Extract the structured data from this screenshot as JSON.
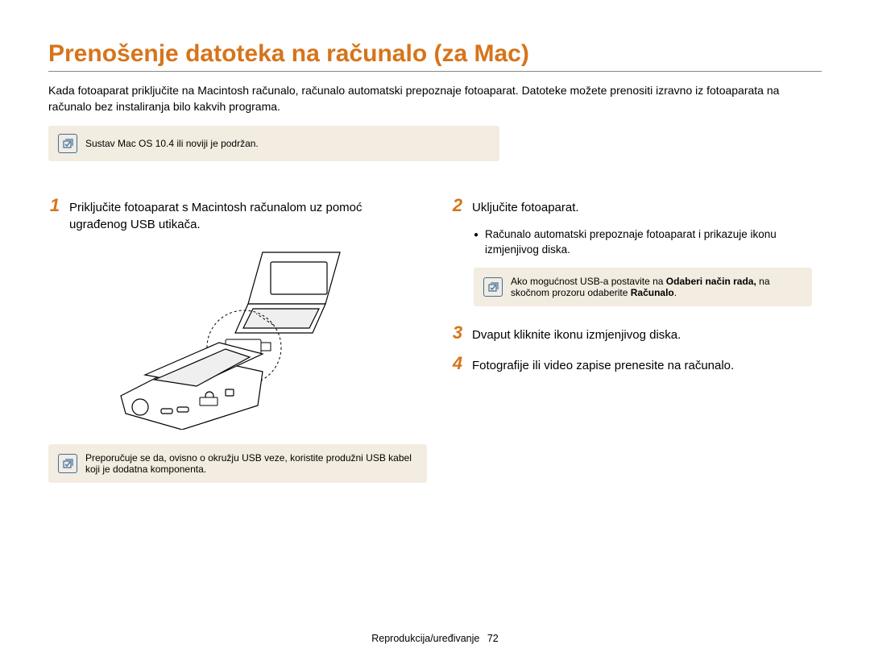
{
  "title": "Prenošenje datoteka na računalo (za Mac)",
  "intro": "Kada fotoaparat priključite na Macintosh računalo, računalo automatski prepoznaje fotoaparat. Datoteke možete prenositi izravno iz fotoaparata na računalo bez instaliranja bilo kakvih programa.",
  "top_note": "Sustav Mac OS 10.4 ili noviji je podržan.",
  "left": {
    "step1_num": "1",
    "step1_text": "Priključite fotoaparat s Macintosh računalom uz pomoć ugrađenog USB utikača.",
    "note": "Preporučuje se da, ovisno o okružju USB veze, koristite produžni USB kabel koji je dodatna komponenta."
  },
  "right": {
    "step2_num": "2",
    "step2_text": "Uključite fotoaparat.",
    "step2_sub": "Računalo automatski prepoznaje fotoaparat i prikazuje ikonu izmjenjivog diska.",
    "note_pre": "Ako mogućnost USB-a postavite na ",
    "note_b1": "Odaberi način rada,",
    "note_mid": " na skočnom prozoru odaberite ",
    "note_b2": "Računalo",
    "note_post": ".",
    "step3_num": "3",
    "step3_text": "Dvaput kliknite ikonu izmjenjivog diska.",
    "step4_num": "4",
    "step4_text": "Fotografije ili video zapise prenesite na računalo."
  },
  "footer": {
    "section": "Reprodukcija/uređivanje",
    "page": "72"
  }
}
